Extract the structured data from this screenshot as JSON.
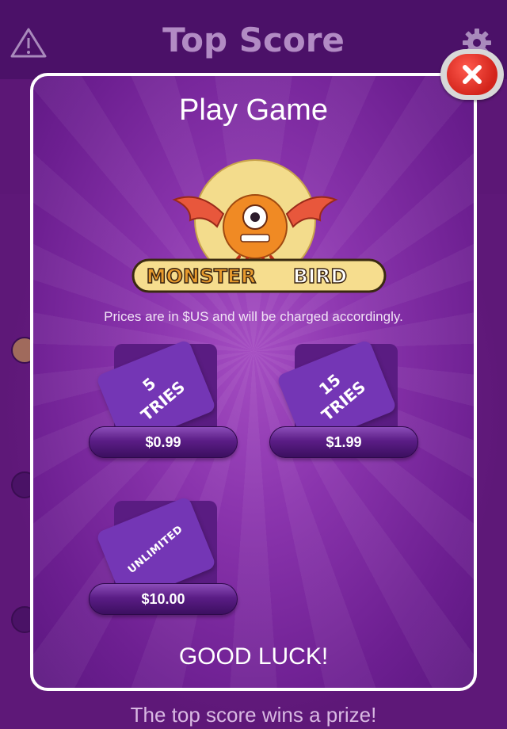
{
  "app": {
    "title": "Top Score",
    "footer": "The top score wins a prize!"
  },
  "modal": {
    "title": "Play Game",
    "logo_text_1": "MONSTER",
    "logo_text_2": "BIRD",
    "prices_note": "Prices are in $US and will be charged accordingly.",
    "packages": [
      {
        "tries_line1": "5",
        "tries_line2": "TRIES",
        "price": "$0.99"
      },
      {
        "tries_line1": "15",
        "tries_line2": "TRIES",
        "price": "$1.99"
      },
      {
        "tries_line1": "UNLIMITED",
        "tries_line2": "",
        "price": "$10.00"
      }
    ],
    "footer": "GOOD LUCK!"
  },
  "colors": {
    "header": "#4b1168",
    "modal_border": "#ffffff",
    "button": "#5b1d86",
    "close": "#d3241b"
  },
  "icons": {
    "warning": "warning-triangle-icon",
    "settings": "gear-icon",
    "close": "close-icon"
  }
}
